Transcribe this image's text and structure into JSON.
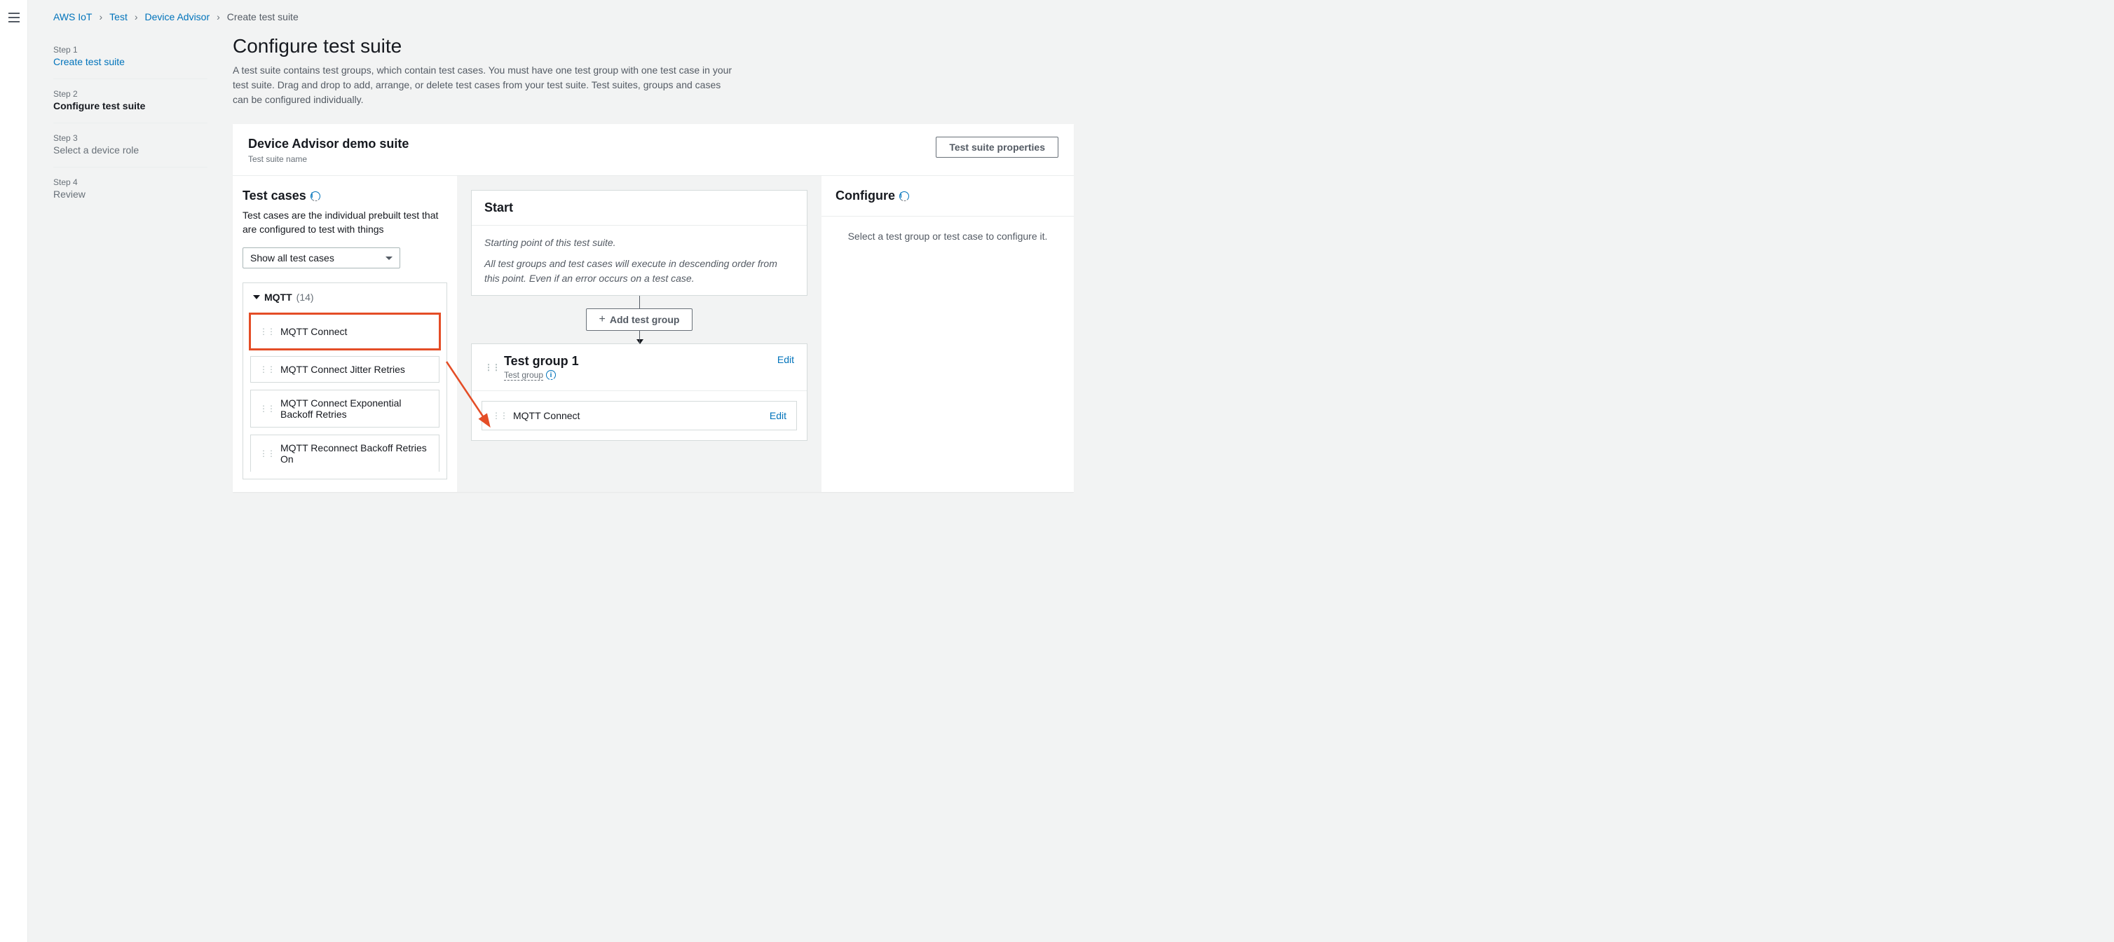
{
  "breadcrumbs": {
    "items": [
      {
        "label": "AWS IoT",
        "link": true
      },
      {
        "label": "Test",
        "link": true
      },
      {
        "label": "Device Advisor",
        "link": true
      },
      {
        "label": "Create test suite",
        "link": false
      }
    ]
  },
  "steps": [
    {
      "num": "Step 1",
      "title": "Create test suite",
      "state": "link"
    },
    {
      "num": "Step 2",
      "title": "Configure test suite",
      "state": "active"
    },
    {
      "num": "Step 3",
      "title": "Select a device role",
      "state": "disabled"
    },
    {
      "num": "Step 4",
      "title": "Review",
      "state": "disabled"
    }
  ],
  "page": {
    "title": "Configure test suite",
    "subtitle": "A test suite contains test groups, which contain test cases. You must have one test group with one test case in your test suite. Drag and drop to add, arrange, or delete test cases from your test suite. Test suites, groups and cases can be configured individually."
  },
  "suite_panel": {
    "title": "Device Advisor demo suite",
    "subtitle": "Test suite name",
    "properties_btn": "Test suite properties"
  },
  "testcases": {
    "heading": "Test cases",
    "desc": "Test cases are the individual prebuilt test that are configured to test with things",
    "filter_label": "Show all test cases",
    "group_name": "MQTT",
    "group_count": "(14)",
    "items": [
      "MQTT Connect",
      "MQTT Connect Jitter Retries",
      "MQTT Connect Exponential Backoff Retries",
      "MQTT Reconnect Backoff Retries On"
    ]
  },
  "flow": {
    "start_title": "Start",
    "start_p1": "Starting point of this test suite.",
    "start_p2": "All test groups and test cases will execute in descending order from this point. Even if an error occurs on a test case.",
    "add_group_btn": "Add test group",
    "group": {
      "title": "Test group 1",
      "sub": "Test group",
      "edit": "Edit",
      "item": "MQTT Connect",
      "item_edit": "Edit"
    }
  },
  "configure": {
    "heading": "Configure",
    "msg": "Select a test group or test case to configure it."
  }
}
